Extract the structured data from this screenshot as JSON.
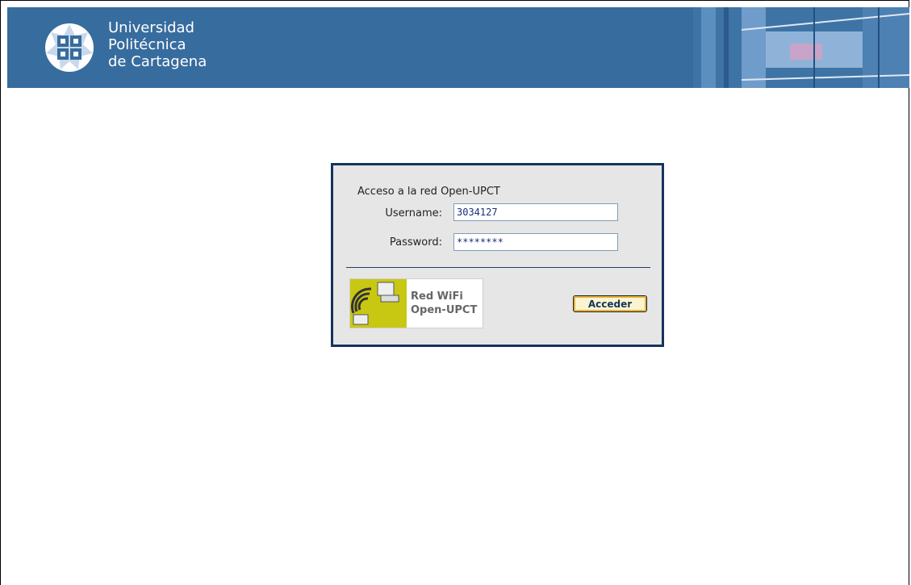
{
  "header": {
    "university_lines": [
      "Universidad",
      "Politécnica",
      "de Cartagena"
    ],
    "logo_icon": "upct-emblem-icon",
    "brand_color": "#376c9e"
  },
  "login": {
    "title": "Acceso a la red Open-UPCT",
    "username_label": "Username:",
    "username_value": "3034127",
    "password_label": "Password:",
    "password_value": "********",
    "wifi_logo_lines": [
      "Red WiFi",
      "Open-UPCT"
    ],
    "submit_label": "Acceder",
    "border_color": "#14345c"
  }
}
